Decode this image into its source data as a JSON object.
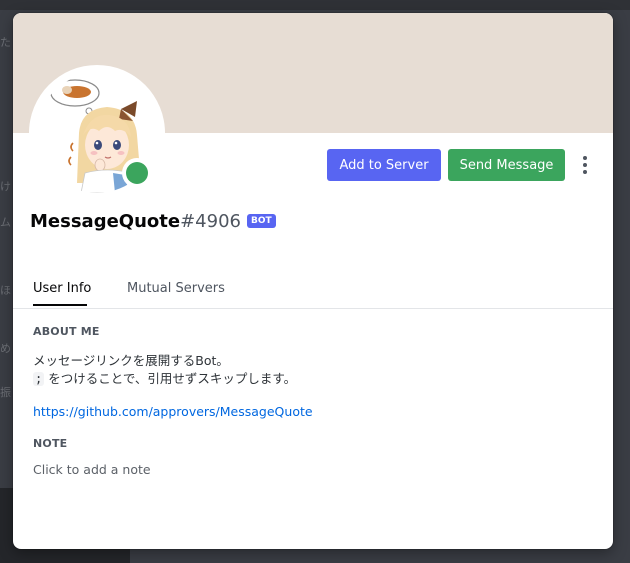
{
  "profile": {
    "username": "MessageQuote",
    "discriminator": "#4906",
    "bot_tag": "BOT",
    "status": "online"
  },
  "buttons": {
    "add_to_server": "Add to Server",
    "send_message": "Send Message"
  },
  "tabs": [
    {
      "label": "User Info",
      "active": true
    },
    {
      "label": "Mutual Servers",
      "active": false
    }
  ],
  "about": {
    "title": "ABOUT ME",
    "line1": "メッセージリンクを展開するBot。",
    "code_char": ";",
    "line2_rest": " をつけることで、引用せずスキップします。",
    "link": "https://github.com/approvers/MessageQuote"
  },
  "note": {
    "title": "NOTE",
    "placeholder": "Click to add a note"
  },
  "colors": {
    "banner": "#e7ddd4",
    "blurple": "#5865f2",
    "green": "#3ba55d",
    "link": "#0067e0"
  }
}
